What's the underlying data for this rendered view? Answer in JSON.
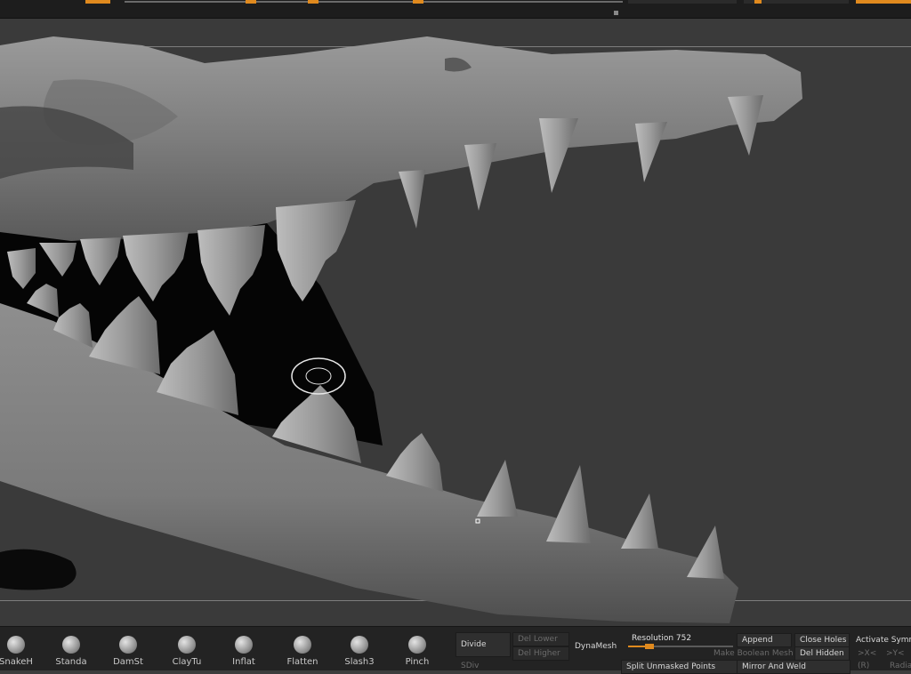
{
  "brushes": [
    {
      "label": "SnakeH",
      "icon": "snakehook-brush-icon"
    },
    {
      "label": "Standa",
      "icon": "standard-brush-icon"
    },
    {
      "label": "DamSt",
      "icon": "damstandard-brush-icon"
    },
    {
      "label": "ClayTu",
      "icon": "claytubes-brush-icon"
    },
    {
      "label": "Inflat",
      "icon": "inflate-brush-icon"
    },
    {
      "label": "Flatten",
      "icon": "flatten-brush-icon"
    },
    {
      "label": "Slash3",
      "icon": "slash3-brush-icon"
    },
    {
      "label": "Pinch",
      "icon": "pinch-brush-icon"
    }
  ],
  "geometry": {
    "divide": "Divide",
    "sdiv": "SDiv",
    "del_lower": "Del Lower",
    "del_higher": "Del Higher",
    "dynamesh": "DynaMesh",
    "resolution_label": "Resolution",
    "resolution_value": "752",
    "resolution_fraction": 0.2,
    "append": "Append",
    "make_boolean_mesh": "Make Boolean Mesh",
    "close_holes": "Close Holes",
    "del_hidden": "Del Hidden",
    "split_unmasked_points": "Split Unmasked Points",
    "mirror_and_weld": "Mirror And Weld"
  },
  "symmetry": {
    "activate": "Activate Symme",
    "x": ">X<",
    "y": ">Y<",
    "r": "(R)",
    "radial": "Radia"
  },
  "colors": {
    "accent": "#e08a1e",
    "ui_bg": "#232323",
    "viewport_bg": "#3a3a3a"
  }
}
